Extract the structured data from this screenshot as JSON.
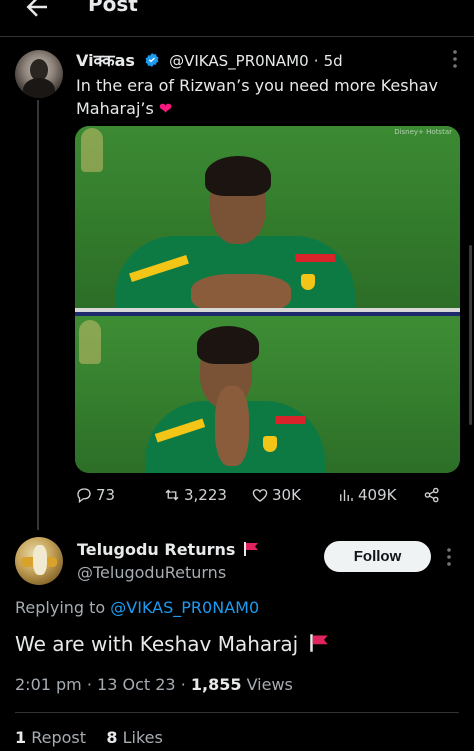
{
  "header": {
    "title": "Post",
    "back_icon": "arrow-left-icon"
  },
  "tweet": {
    "author_name": "Viक्कas",
    "verified_icon": "verified-badge-icon",
    "handle": "@VIKAS_PR0NAM0",
    "separator": "·",
    "age": "5d",
    "text": "In the era of Rizwan’s you need more Keshav Maharaj’s",
    "emoji": "❤",
    "media_corner_text": "Disney+ Hotstar",
    "actions": {
      "replies": "73",
      "reposts": "3,223",
      "likes": "30K",
      "views": "409K"
    }
  },
  "reply": {
    "author_name": "Telugodu Returns",
    "flag_icon": "red-flag-icon",
    "handle": "@TelugoduReturns",
    "follow_label": "Follow",
    "replying_prefix": "Replying to ",
    "replying_handle": "@VIKAS_PR0NAM0",
    "text": "We are with Keshav Maharaj",
    "time": "2:01 pm",
    "date": "13 Oct 23",
    "views_count": "1,855",
    "views_label": "Views",
    "repost_count": "1",
    "repost_label": "Repost",
    "likes_count": "8",
    "likes_label": "Likes"
  },
  "colors": {
    "accent": "#1d9bf0",
    "heart": "#f91880",
    "flag": "#e0245e",
    "background": "#000000"
  }
}
